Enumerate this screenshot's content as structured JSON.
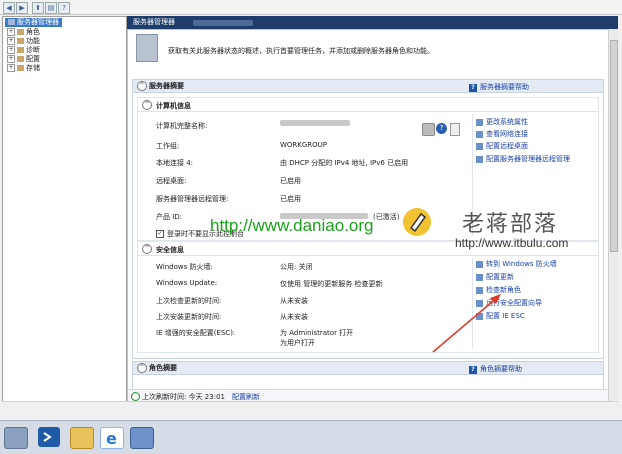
{
  "toolbar": {
    "back": "◀",
    "forward": "▶",
    "up": "⬆",
    "show": "▤",
    "help": "?"
  },
  "tree": {
    "root": "服务器管理器",
    "items": [
      {
        "label": "角色",
        "toggle": "+"
      },
      {
        "label": "功能",
        "toggle": "+"
      },
      {
        "label": "诊断",
        "toggle": "+"
      },
      {
        "label": "配置",
        "toggle": "+"
      },
      {
        "label": "存储",
        "toggle": "+"
      }
    ]
  },
  "main": {
    "title": "服务器管理器",
    "intro": "获取有关此服务器状态的概述，执行首要管理任务，并添加或删除服务器角色和功能。",
    "summary": {
      "title": "服务器摘要",
      "help": "服务器摘要帮助",
      "computer": {
        "title": "计算机信息",
        "rows": [
          {
            "label": "计算机完整名称:",
            "value": ""
          },
          {
            "label": "工作组:",
            "value": "WORKGROUP"
          },
          {
            "label": "本地连接 4:",
            "value": "由 DHCP 分配的 IPv4 地址, IPv6 已启用"
          },
          {
            "label": "远程桌面:",
            "value": "已启用"
          },
          {
            "label": "服务器管理器远程管理:",
            "value": "已启用"
          },
          {
            "label": "产品 ID:",
            "value": "(已激活)"
          }
        ],
        "checkbox": "登录时不要显示此控制台",
        "links": [
          "更改系统属性",
          "查看网络连接",
          "配置远程桌面",
          "配置服务器管理器远程管理"
        ]
      },
      "security": {
        "title": "安全信息",
        "rows": [
          {
            "label": "Windows 防火墙:",
            "value": "公用: 关闭"
          },
          {
            "label": "Windows Update:",
            "value": "仅使用 管理的更新服务 检查更新"
          },
          {
            "label": "上次检查更新的时间:",
            "value": "从未安装"
          },
          {
            "label": "上次安装更新的时间:",
            "value": "从未安装"
          },
          {
            "label": "IE 增强的安全配置(ESC):",
            "value": "为 Administrator 打开",
            "value2": "为用户打开"
          }
        ],
        "links": [
          "转到 Windows 防火墙",
          "配置更新",
          "检查新角色",
          "运行安全配置向导",
          "配置 IE ESC"
        ]
      }
    },
    "roles": {
      "title": "角色摘要",
      "help": "角色摘要帮助"
    },
    "status": {
      "refresh_text": "上次刷新时间: 今天 23:01",
      "refresh_link": "配置刷新"
    }
  },
  "watermarks": {
    "site_url": "http://www.daniao.org",
    "brand": "老蒋部落",
    "brand_url": "http://www.itbulu.com"
  },
  "taskbar": {
    "icons": [
      "server-manager-icon",
      "powershell-icon",
      "explorer-icon",
      "ie-icon",
      "remote-desktop-icon"
    ]
  },
  "colors": {
    "header_bg": "#1e3d6b",
    "link": "#1a3fa8",
    "annotation_arrow": "#e23a2a",
    "watermark_green": "#1aa21a"
  }
}
